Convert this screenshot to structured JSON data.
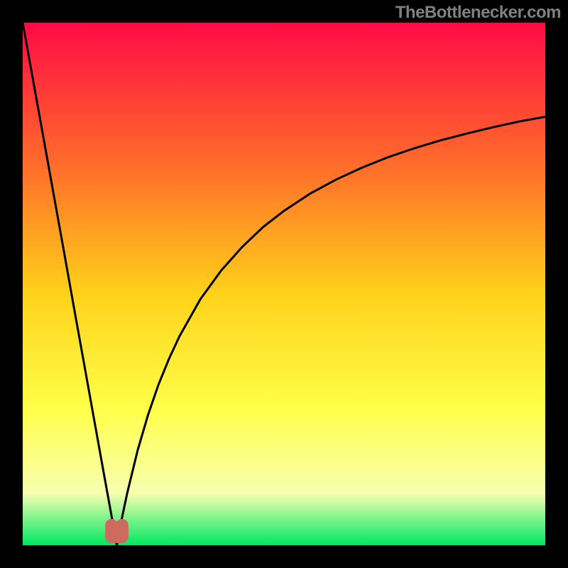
{
  "watermark": "TheBottlenecker.com",
  "chart_data": {
    "type": "line",
    "title": "",
    "xlabel": "",
    "ylabel": "",
    "xlim": [
      0,
      100
    ],
    "ylim": [
      0,
      100
    ],
    "x_min_at": 18,
    "series": [
      {
        "name": "bottleneck-curve",
        "note": "V-shaped curve; y = |x - 18| / max(x, 18) * 100 (approx). Minimum ≈ 0 at x ≈ 18; left arm rises to 100 at x=0; right arm asymptotes toward ~82 at x=100.",
        "points": [
          {
            "x": 0,
            "y": 100
          },
          {
            "x": 2,
            "y": 88.9
          },
          {
            "x": 4,
            "y": 77.8
          },
          {
            "x": 6,
            "y": 66.7
          },
          {
            "x": 8,
            "y": 55.6
          },
          {
            "x": 10,
            "y": 44.4
          },
          {
            "x": 12,
            "y": 33.3
          },
          {
            "x": 14,
            "y": 22.2
          },
          {
            "x": 16,
            "y": 11.1
          },
          {
            "x": 17,
            "y": 5.6
          },
          {
            "x": 18,
            "y": 0.0
          },
          {
            "x": 19,
            "y": 5.3
          },
          {
            "x": 20,
            "y": 10.0
          },
          {
            "x": 22,
            "y": 18.2
          },
          {
            "x": 24,
            "y": 25.0
          },
          {
            "x": 26,
            "y": 30.8
          },
          {
            "x": 28,
            "y": 35.7
          },
          {
            "x": 30,
            "y": 40.0
          },
          {
            "x": 34,
            "y": 47.1
          },
          {
            "x": 38,
            "y": 52.6
          },
          {
            "x": 42,
            "y": 57.1
          },
          {
            "x": 46,
            "y": 60.9
          },
          {
            "x": 50,
            "y": 64.0
          },
          {
            "x": 55,
            "y": 67.3
          },
          {
            "x": 60,
            "y": 70.0
          },
          {
            "x": 65,
            "y": 72.3
          },
          {
            "x": 70,
            "y": 74.3
          },
          {
            "x": 75,
            "y": 76.0
          },
          {
            "x": 80,
            "y": 77.5
          },
          {
            "x": 85,
            "y": 78.8
          },
          {
            "x": 90,
            "y": 80.0
          },
          {
            "x": 95,
            "y": 81.1
          },
          {
            "x": 100,
            "y": 82.0
          }
        ]
      },
      {
        "name": "highlight-blob",
        "note": "rounded marker at curve minimum",
        "points": [
          {
            "x": 17,
            "y": 3
          },
          {
            "x": 19,
            "y": 3
          }
        ]
      }
    ],
    "colors": {
      "curve": "#000000",
      "highlight": "#cf6a61",
      "frame": "#000000",
      "gradient_top": "#ff0b45",
      "gradient_mid_upper": "#ff6f2a",
      "gradient_mid": "#ffd21a",
      "gradient_mid_lower": "#ffff4a",
      "gradient_lower": "#f7ffb0",
      "gradient_bottom": "#00e763"
    }
  }
}
